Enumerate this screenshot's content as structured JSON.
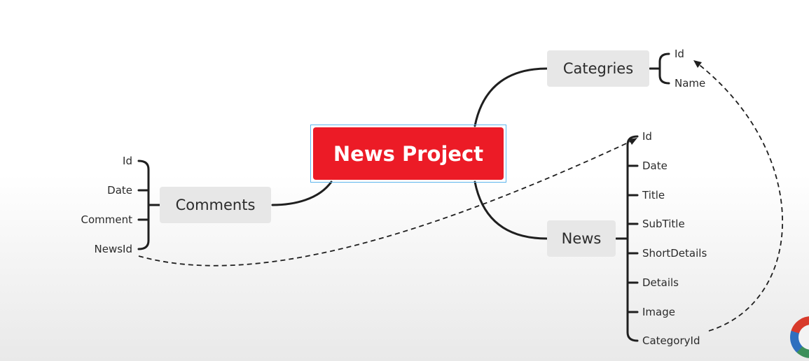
{
  "root": {
    "label": "News Project"
  },
  "nodes": {
    "categories": {
      "label": "Categries",
      "fields": [
        "Id",
        "Name"
      ]
    },
    "news": {
      "label": "News",
      "fields": [
        "Id",
        "Date",
        "Title",
        "SubTitle",
        "ShortDetails",
        "Details",
        "Image",
        "CategoryId"
      ]
    },
    "comments": {
      "label": "Comments",
      "fields": [
        "Id",
        "Date",
        "Comment",
        "NewsId"
      ]
    }
  },
  "relations": [
    {
      "from": "comments.NewsId",
      "to": "news.Id"
    },
    {
      "from": "news.CategoryId",
      "to": "categories.Id"
    }
  ],
  "colors": {
    "root": "#ec1b26",
    "selection": "#5fb6ee",
    "node": "#e7e7e7",
    "line": "#1f1f1f"
  }
}
